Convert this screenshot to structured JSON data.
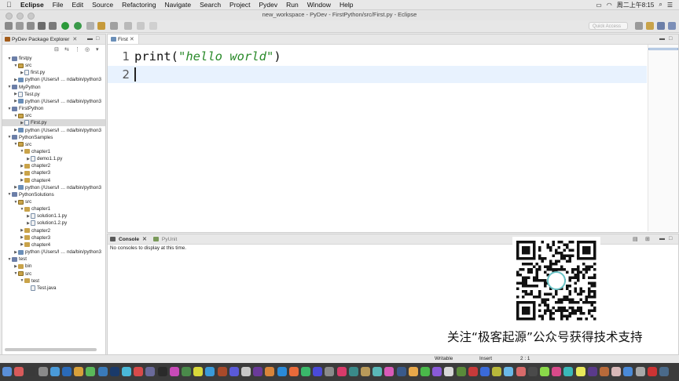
{
  "menubar": {
    "app": "Eclipse",
    "items": [
      "File",
      "Edit",
      "Source",
      "Refactoring",
      "Navigate",
      "Search",
      "Project",
      "Pydev",
      "Run",
      "Window",
      "Help"
    ],
    "clock": "周二上午8:15"
  },
  "window": {
    "title": "new_workspace - PyDev - FirstPython/src/First.py - Eclipse"
  },
  "toolbar": {
    "quick_access_placeholder": "Quick Access"
  },
  "explorer": {
    "title": "PyDev Package Explorer",
    "rows": [
      {
        "label": "firstpy",
        "indent": 0,
        "icon": "proj",
        "tw": "▼"
      },
      {
        "label": "src",
        "indent": 1,
        "icon": "src",
        "tw": "▼"
      },
      {
        "label": "first.py",
        "indent": 2,
        "icon": "file",
        "tw": "▶"
      },
      {
        "label": "python  (/Users/l … nda/bin/python3",
        "indent": 1,
        "icon": "py",
        "tw": "▶"
      },
      {
        "label": "MyPython",
        "indent": 0,
        "icon": "proj",
        "tw": "▼"
      },
      {
        "label": "Test.py",
        "indent": 1,
        "icon": "file",
        "tw": "▶"
      },
      {
        "label": "python  (/Users/l … nda/bin/python3",
        "indent": 1,
        "icon": "py",
        "tw": "▶"
      },
      {
        "label": "FirstPython",
        "indent": 0,
        "icon": "proj",
        "tw": "▼"
      },
      {
        "label": "src",
        "indent": 1,
        "icon": "src",
        "tw": "▼"
      },
      {
        "label": "First.py",
        "indent": 2,
        "icon": "file",
        "tw": "▶",
        "selected": true
      },
      {
        "label": "python  (/Users/l … nda/bin/python3",
        "indent": 1,
        "icon": "py",
        "tw": "▶"
      },
      {
        "label": "PythonSamples",
        "indent": 0,
        "icon": "proj",
        "tw": "▼"
      },
      {
        "label": "src",
        "indent": 1,
        "icon": "src",
        "tw": "▼"
      },
      {
        "label": "chapter1",
        "indent": 2,
        "icon": "folder",
        "tw": "▼"
      },
      {
        "label": "demo1.1.py",
        "indent": 3,
        "icon": "file",
        "tw": "▶"
      },
      {
        "label": "chapter2",
        "indent": 2,
        "icon": "folder",
        "tw": "▶"
      },
      {
        "label": "chapter3",
        "indent": 2,
        "icon": "folder",
        "tw": "▶"
      },
      {
        "label": "chapter4",
        "indent": 2,
        "icon": "folder",
        "tw": "▶"
      },
      {
        "label": "python  (/Users/l … nda/bin/python3",
        "indent": 1,
        "icon": "py",
        "tw": "▶"
      },
      {
        "label": "PythonSolutions",
        "indent": 0,
        "icon": "proj",
        "tw": "▼"
      },
      {
        "label": "src",
        "indent": 1,
        "icon": "src",
        "tw": "▼"
      },
      {
        "label": "chapter1",
        "indent": 2,
        "icon": "folder",
        "tw": "▼"
      },
      {
        "label": "solution1.1.py",
        "indent": 3,
        "icon": "file",
        "tw": "▶"
      },
      {
        "label": "solution1.2.py",
        "indent": 3,
        "icon": "file",
        "tw": "▶"
      },
      {
        "label": "chapter2",
        "indent": 2,
        "icon": "folder",
        "tw": "▶"
      },
      {
        "label": "chapter3",
        "indent": 2,
        "icon": "folder",
        "tw": "▶"
      },
      {
        "label": "chapter4",
        "indent": 2,
        "icon": "folder",
        "tw": "▶"
      },
      {
        "label": "python  (/Users/l … nda/bin/python3",
        "indent": 1,
        "icon": "py",
        "tw": "▶"
      },
      {
        "label": "test",
        "indent": 0,
        "icon": "proj",
        "tw": "▼"
      },
      {
        "label": "bin",
        "indent": 1,
        "icon": "folder",
        "tw": "▶"
      },
      {
        "label": "src",
        "indent": 1,
        "icon": "src",
        "tw": "▼"
      },
      {
        "label": "test",
        "indent": 2,
        "icon": "folder",
        "tw": "▼"
      },
      {
        "label": "Test.java",
        "indent": 3,
        "icon": "file",
        "tw": ""
      }
    ]
  },
  "editor": {
    "tab": "First",
    "lines": [
      {
        "num": "1",
        "func": "print(",
        "str": "\"hello world\"",
        "end": ")"
      },
      {
        "num": "2",
        "func": "",
        "str": "",
        "end": ""
      }
    ]
  },
  "console": {
    "tab": "Console",
    "tab2": "PyUnit",
    "message": "No consoles to display at this time."
  },
  "watermark": {
    "text": "关注“极客起源”公众号获得技术支持"
  },
  "status": {
    "mode": "Writable",
    "insert": "Insert",
    "position": "2 : 1"
  }
}
